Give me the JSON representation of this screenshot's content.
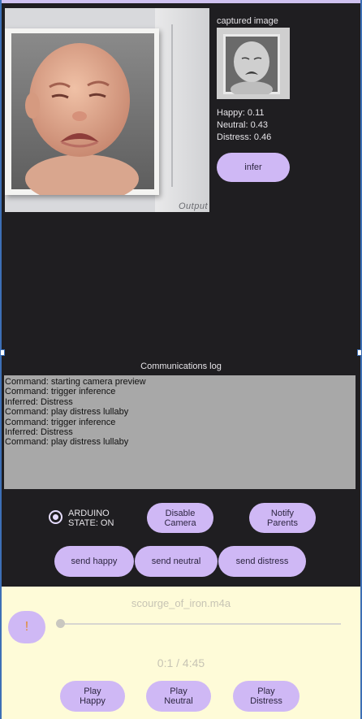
{
  "preview": {
    "print_text": "Output"
  },
  "captured": {
    "label": "captured image"
  },
  "scores": {
    "happy": "Happy: 0.11",
    "neutral": "Neutral: 0.43",
    "distress": "Distress: 0.46"
  },
  "infer_button": "infer",
  "log": {
    "title": "Communications log",
    "lines": [
      "Command: starting camera preview",
      "Command: trigger inference",
      "Inferred: Distress",
      "Command: play distress lullaby",
      "Command: trigger inference",
      "Inferred: Distress",
      "Command: play distress lullaby"
    ]
  },
  "arduino": {
    "line1": "ARDUINO",
    "line2": "STATE: ON",
    "selected": true
  },
  "controls": {
    "disable_camera": [
      "Disable",
      "Camera"
    ],
    "notify_parents": [
      "Notify",
      "Parents"
    ],
    "send_happy": "send happy",
    "send_neutral": "send neutral",
    "send_distress": "send distress"
  },
  "player": {
    "track": "scourge_of_iron.m4a",
    "play_glyph": "!",
    "time": "0:1 / 4:45",
    "progress": 0.004,
    "play_happy": [
      "Play",
      "Happy"
    ],
    "play_neutral": [
      "Play",
      "Neutral"
    ],
    "play_distress": [
      "Play",
      "Distress"
    ]
  },
  "colors": {
    "background": "#1f1e21",
    "button": "#cfb8f5",
    "log_background": "#a8a8a8",
    "player_background": "#fefbd8"
  }
}
